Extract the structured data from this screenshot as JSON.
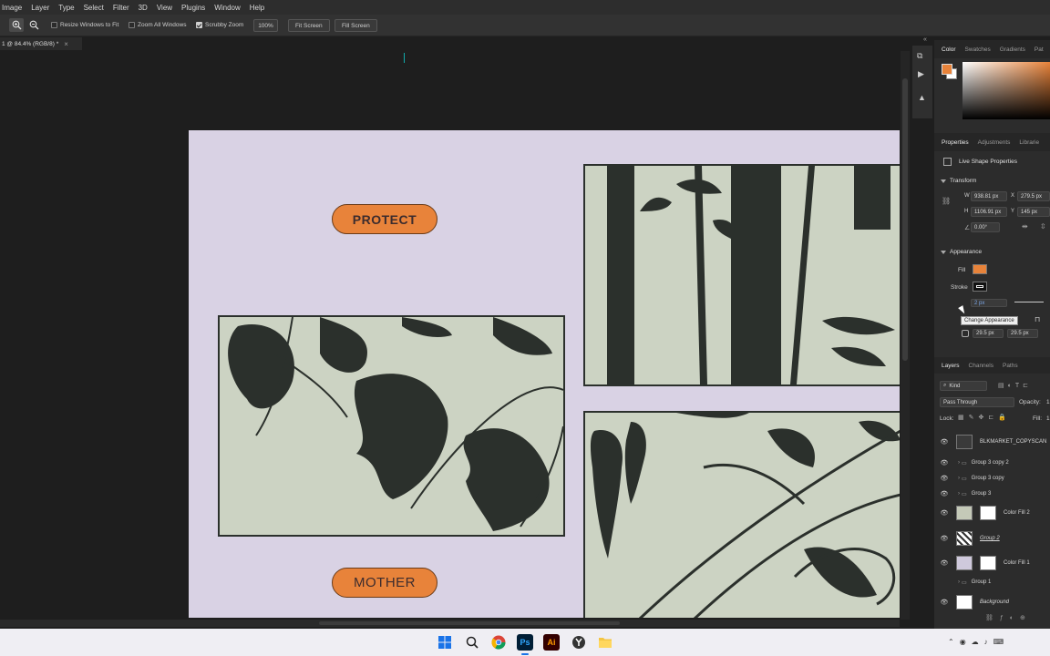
{
  "menu": [
    "Image",
    "Layer",
    "Type",
    "Select",
    "Filter",
    "3D",
    "View",
    "Plugins",
    "Window",
    "Help"
  ],
  "options": {
    "resize_windows": "Resize Windows to Fit",
    "zoom_all": "Zoom All Windows",
    "scrubby_zoom": "Scrubby Zoom",
    "zoom_value": "100%",
    "fit_screen": "Fit Screen",
    "fill_screen": "Fill Screen"
  },
  "doc_tab": {
    "title": "1 @ 84.4% (RGB/8) *",
    "close": "×"
  },
  "artboard": {
    "label_top": "PROTECT",
    "label_bottom": "MOTHER"
  },
  "color_panel": {
    "tabs": [
      "Color",
      "Swatches",
      "Gradients",
      "Pat"
    ],
    "fg_color": "#e8833a",
    "bg_color": "#ffffff"
  },
  "properties": {
    "tabs": [
      "Properties",
      "Adjustments",
      "Librarie"
    ],
    "title": "Live Shape Properties",
    "transform_label": "Transform",
    "w": "938.81 px",
    "x": "279.5 px",
    "h": "1106.91 px",
    "y": "145 px",
    "angle": "0.00°",
    "appearance_label": "Appearance",
    "fill_label": "Fill",
    "fill_color": "#e8833a",
    "stroke_label": "Stroke",
    "stroke_width": "2 px",
    "tooltip": "Change Appearance",
    "radius1": "29.5 px",
    "radius2": "29.5 px"
  },
  "layers": {
    "tabs": [
      "Layers",
      "Channels",
      "Paths"
    ],
    "kind": "Kind",
    "blend": "Pass Through",
    "opacity_label": "Opacity:",
    "opacity": "1",
    "lock_label": "Lock:",
    "fill_label": "Fill:",
    "fill_value": "1",
    "items": [
      {
        "name": "BLKMARKET_COPYSCAN",
        "visible": true
      },
      {
        "name": "Group 3 copy 2",
        "visible": true
      },
      {
        "name": "Group 3 copy",
        "visible": true
      },
      {
        "name": "Group 3",
        "visible": true
      },
      {
        "name": "Color Fill 2",
        "visible": true
      },
      {
        "name": "Group 2",
        "visible": true
      },
      {
        "name": "Color Fill 1",
        "visible": true
      },
      {
        "name": "Group 1",
        "visible": false
      },
      {
        "name": "Background",
        "visible": true
      }
    ]
  },
  "taskbar": {
    "ps_label": "Ps",
    "ai_label": "Ai"
  }
}
